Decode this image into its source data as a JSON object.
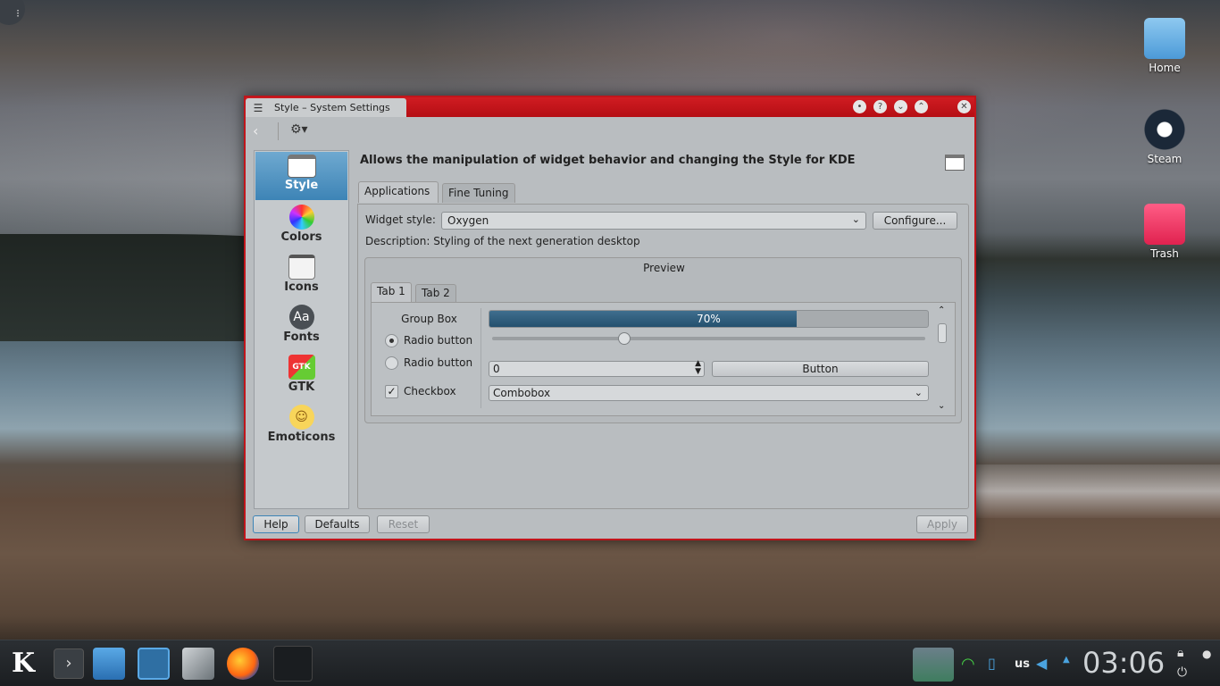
{
  "desktop": {
    "icons": [
      {
        "label": "Home"
      },
      {
        "label": "Steam"
      },
      {
        "label": "Trash"
      }
    ]
  },
  "window": {
    "title": "Style – System Settings",
    "header": "Allows the manipulation of widget behavior and changing the Style for KDE",
    "sidebar": [
      {
        "label": "Style"
      },
      {
        "label": "Colors"
      },
      {
        "label": "Icons"
      },
      {
        "label": "Fonts"
      },
      {
        "label": "GTK"
      },
      {
        "label": "Emoticons"
      }
    ],
    "tabs": [
      "Applications",
      "Fine Tuning"
    ],
    "widget_style_label": "Widget style:",
    "widget_style_value": "Oxygen",
    "configure_label": "Configure...",
    "description": "Description: Styling of the next generation desktop",
    "preview": {
      "title": "Preview",
      "tabs": [
        "Tab 1",
        "Tab 2"
      ],
      "group_box": "Group Box",
      "radio1": "Radio button",
      "radio2": "Radio button",
      "checkbox": "Checkbox",
      "progress_text": "70%",
      "progress": 0.7,
      "spin_value": "0",
      "button": "Button",
      "combobox": "Combobox"
    },
    "buttons": {
      "help": "Help",
      "defaults": "Defaults",
      "reset": "Reset",
      "apply": "Apply"
    }
  },
  "taskbar": {
    "layout": "us",
    "clock": "03:06"
  },
  "colors": {
    "titlebar": "#c0151b",
    "selection": "#3d84b6"
  }
}
